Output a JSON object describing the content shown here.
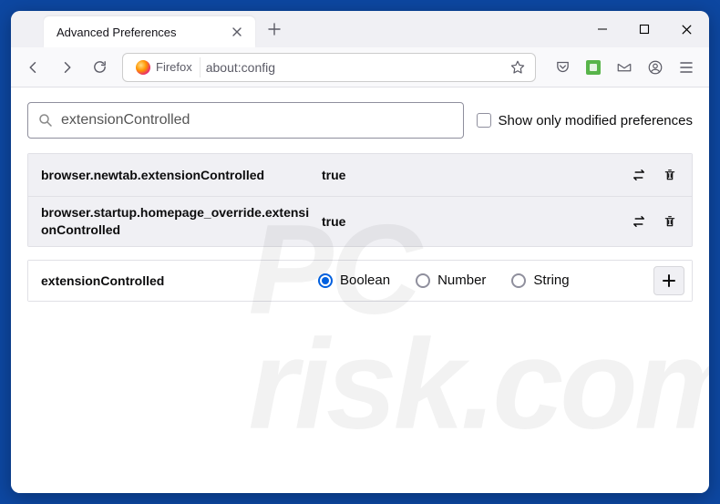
{
  "tab": {
    "title": "Advanced Preferences"
  },
  "urlbar": {
    "identity_label": "Firefox",
    "url": "about:config"
  },
  "search": {
    "value": "extensionControlled",
    "modified_only_label": "Show only modified preferences"
  },
  "prefs": [
    {
      "name": "browser.newtab.extensionControlled",
      "value": "true"
    },
    {
      "name": "browser.startup.homepage_override.extensionControlled",
      "value": "true"
    }
  ],
  "newpref": {
    "name": "extensionControlled",
    "types": {
      "boolean": "Boolean",
      "number": "Number",
      "string": "String"
    },
    "selected": 0
  },
  "watermark": "PC\nrisk.com"
}
